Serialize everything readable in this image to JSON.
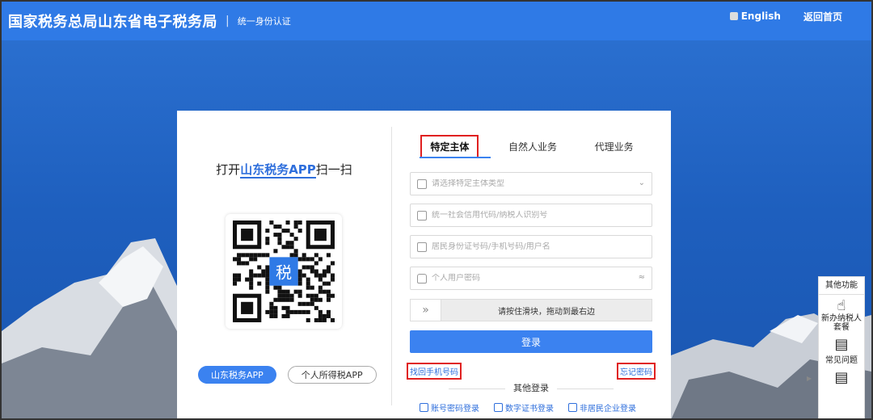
{
  "header": {
    "title": "国家税务总局山东省电子税务局",
    "separator": "|",
    "subtitle": "统一身份认证",
    "english_link": "English",
    "home_link": "返回首页"
  },
  "left_panel": {
    "scan_prefix": "打开",
    "scan_app": "山东税务APP",
    "scan_suffix": "扫一扫",
    "qr_badge": "税",
    "app_button_1": "山东税务APP",
    "app_button_2": "个人所得税APP"
  },
  "tabs": [
    {
      "label": "特定主体",
      "active": true
    },
    {
      "label": "自然人业务",
      "active": false
    },
    {
      "label": "代理业务",
      "active": false
    }
  ],
  "form": {
    "subject_type_placeholder": "请选择特定主体类型",
    "credit_code_placeholder": "统一社会信用代码/纳税人识别号",
    "id_placeholder": "居民身份证号码/手机号码/用户名",
    "password_placeholder": "个人用户密码",
    "slider_text": "请按住滑块，拖动到最右边",
    "login_label": "登录",
    "recover_phone": "找回手机号码",
    "forgot_password": "忘记密码",
    "other_login_title": "其他登录",
    "other_methods": [
      "账号密码登录",
      "数字证书登录",
      "非居民企业登录"
    ]
  },
  "side_panel": {
    "title": "其他功能",
    "items": [
      {
        "label": "新办纳税人套餐",
        "icon": "hand-pointer-icon"
      },
      {
        "label": "常见问题",
        "icon": "faq-icon"
      },
      {
        "label": "",
        "icon": "message-icon"
      }
    ]
  },
  "colors": {
    "header_bg": "#2f7ae6",
    "primary_blue": "#3b82f0",
    "highlight_red": "#e02020"
  }
}
